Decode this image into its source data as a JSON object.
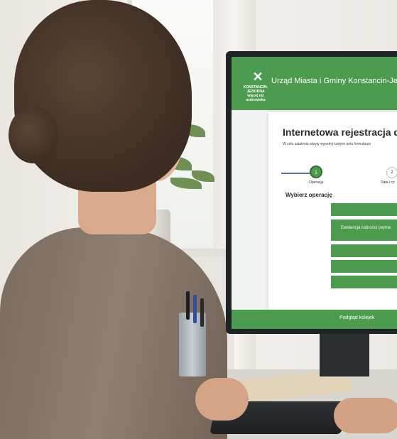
{
  "app": {
    "header": {
      "logo_line1": "KONSTANCIN-",
      "logo_line2": "JEZIORNA",
      "logo_tagline": "więcej niż uzdrowisko",
      "city_name": "Urząd Miasta i Gminy Konstancin-Jeziorna"
    },
    "form": {
      "title": "Internetowa rejestracja do kole",
      "subtitle": "W celu ustalenia wizyty wypełnij kolejne pola formularza",
      "steps": [
        {
          "number": "1",
          "label": "Operacja"
        },
        {
          "number": "2",
          "label": "Data i cz"
        }
      ],
      "section_heading": "Wybierz operację",
      "options": [
        "",
        "Ewidencja ludności (wyme",
        "",
        "",
        ""
      ]
    },
    "footer": {
      "link_label": "Podgląd kolejek"
    }
  },
  "colors": {
    "brand_green": "#4c9b4f",
    "step_line": "#5b6fb4"
  }
}
